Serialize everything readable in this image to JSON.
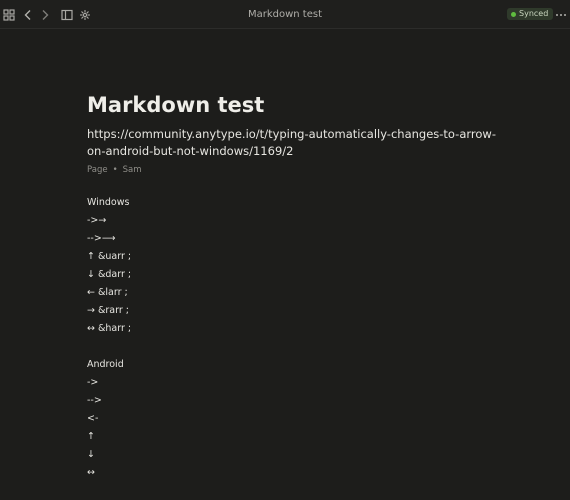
{
  "window": {
    "title": "Markdown test",
    "sync_status": "Synced",
    "sync_color": "#5fbd3f"
  },
  "toolbar": {
    "icons": [
      "widgets-icon",
      "back-icon",
      "forward-icon",
      "sidebar-icon",
      "graph-icon",
      "more-icon"
    ]
  },
  "page": {
    "title": "Markdown test",
    "description": "https://community.anytype.io/t/typing-automatically-changes-to-arrow-on-android-but-not-windows/1169/2",
    "type": "Page",
    "author": "Sam"
  },
  "blocks": [
    "Windows",
    "->→",
    "-->⟶",
    "↑ &uarr ;",
    "↓ &darr ;",
    "← &larr ;",
    "→ &rarr ;",
    "↔ &harr ;",
    "",
    "Android",
    "->",
    "-->",
    "<-",
    "↑",
    "↓",
    "↔"
  ]
}
